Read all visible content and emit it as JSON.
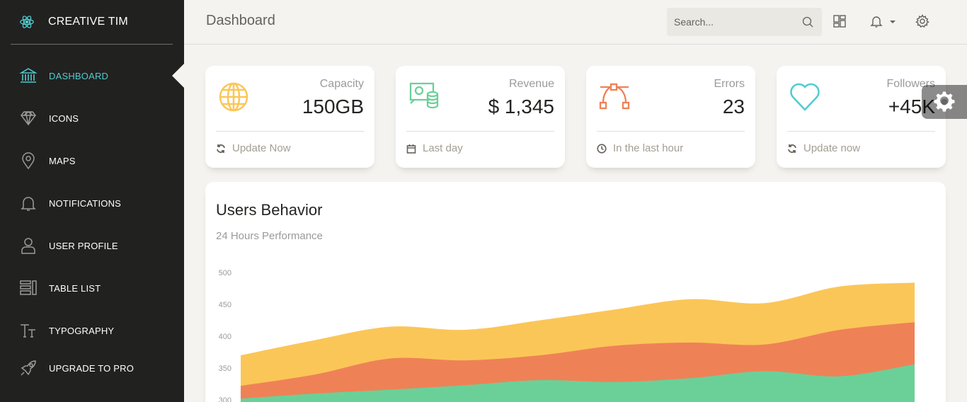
{
  "brand": {
    "name": "CREATIVE TIM",
    "icon": "react-atom-icon"
  },
  "sidebar": {
    "items": [
      {
        "label": "DASHBOARD",
        "icon": "bank-icon",
        "active": true
      },
      {
        "label": "ICONS",
        "icon": "diamond-icon"
      },
      {
        "label": "MAPS",
        "icon": "pin-icon"
      },
      {
        "label": "NOTIFICATIONS",
        "icon": "bell-icon"
      },
      {
        "label": "USER PROFILE",
        "icon": "user-icon"
      },
      {
        "label": "TABLE LIST",
        "icon": "tile-icon"
      },
      {
        "label": "TYPOGRAPHY",
        "icon": "caps-icon"
      },
      {
        "label": "UPGRADE TO PRO",
        "icon": "rocket-icon"
      }
    ]
  },
  "navbar": {
    "title": "Dashboard",
    "search_placeholder": "Search...",
    "icons": [
      "search-icon",
      "layout-icon",
      "bell-icon",
      "settings-icon"
    ]
  },
  "stats": [
    {
      "category": "Capacity",
      "value": "150GB",
      "footer": "Update Now",
      "icon": "globe-icon",
      "footer_icon": "refresh-icon",
      "color": "#fbc658"
    },
    {
      "category": "Revenue",
      "value": "$ 1,345",
      "footer": "Last day",
      "icon": "money-coins-icon",
      "footer_icon": "calendar-icon",
      "color": "#6bd098"
    },
    {
      "category": "Errors",
      "value": "23",
      "footer": "In the last hour",
      "icon": "vector-icon",
      "footer_icon": "clock-icon",
      "color": "#ef8157"
    },
    {
      "category": "Followers",
      "value": "+45K",
      "footer": "Update now",
      "icon": "heart-icon",
      "footer_icon": "refresh-icon",
      "color": "#51cbce"
    }
  ],
  "chart": {
    "title": "Users Behavior",
    "subtitle": "24 Hours Performance"
  },
  "chart_data": {
    "type": "area",
    "title": "Users Behavior",
    "subtitle": "24 Hours Performance",
    "ylim": [
      300,
      500
    ],
    "yticks": [
      300,
      350,
      400,
      450,
      500
    ],
    "x": [
      0,
      1,
      2,
      3,
      4,
      5,
      6,
      7,
      8,
      9
    ],
    "series": [
      {
        "color": "#fbc658",
        "values": [
          370,
          394,
          415,
          410,
          425,
          442,
          458,
          452,
          478,
          484
        ]
      },
      {
        "color": "#ef8157",
        "values": [
          322,
          340,
          365,
          362,
          370,
          385,
          390,
          387,
          410,
          422
        ]
      },
      {
        "color": "#6bd098",
        "values": [
          302,
          310,
          316,
          323,
          331,
          328,
          334,
          345,
          337,
          356
        ]
      }
    ],
    "grid": false,
    "legend": "none"
  },
  "colors": {
    "accent": "#51cbce",
    "sidebar_bg": "#212120",
    "page_bg": "#f4f3ef"
  }
}
